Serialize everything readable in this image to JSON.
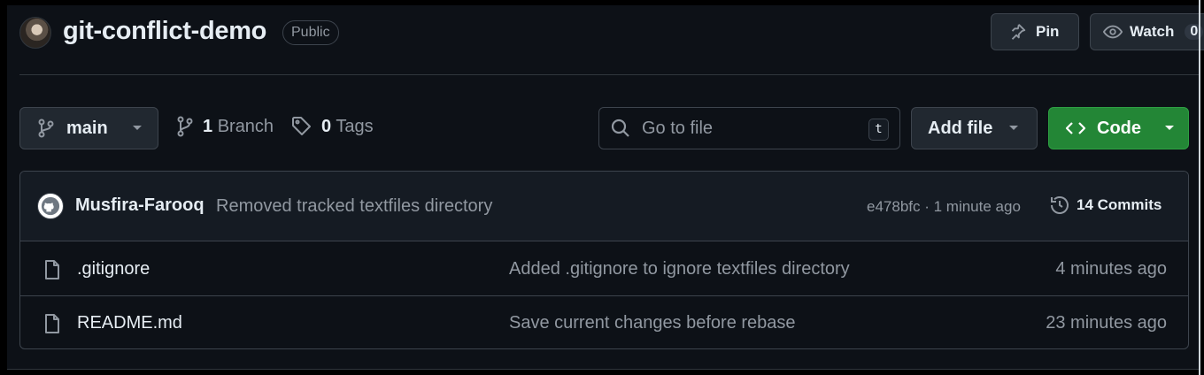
{
  "repo": {
    "name": "git-conflict-demo",
    "visibility": "Public"
  },
  "header_actions": {
    "pin_label": "Pin",
    "watch_label": "Watch",
    "watch_count": "0"
  },
  "toolbar": {
    "branch_name": "main",
    "branch_count": "1",
    "branch_label": "Branch",
    "tag_count": "0",
    "tag_label": "Tags",
    "search_placeholder": "Go to file",
    "search_shortcut": "t",
    "add_file_label": "Add file",
    "code_label": "Code"
  },
  "latest_commit": {
    "author": "Musfira-Farooq",
    "message": "Removed tracked textfiles directory",
    "meta": "e478bfc · 1 minute ago",
    "commits_label": "14 Commits"
  },
  "files": [
    {
      "name": ".gitignore",
      "message": "Added .gitignore to ignore textfiles directory",
      "time": "4 minutes ago"
    },
    {
      "name": "README.md",
      "message": "Save current changes before rebase",
      "time": "23 minutes ago"
    }
  ],
  "colors": {
    "background": "#0d1117",
    "border": "#3d444d",
    "muted_text": "#9198a1",
    "primary_button": "#238636"
  }
}
